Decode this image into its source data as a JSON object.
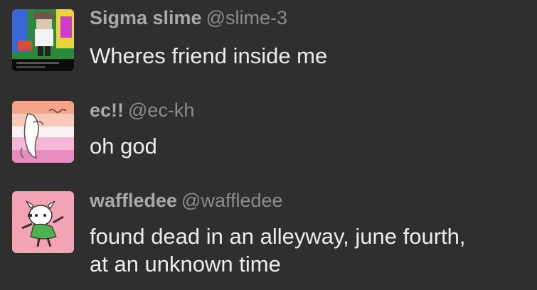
{
  "posts": [
    {
      "name": "Sigma slime",
      "handle": "@slime-3",
      "text": "Wheres friend inside me",
      "avatar_icon": "roblox-character-avatar"
    },
    {
      "name": "ec!!",
      "handle": "@ec-kh",
      "text": "oh god",
      "avatar_icon": "striped-flag-doodle-avatar"
    },
    {
      "name": "waffledee",
      "handle": "@waffledee",
      "text_lines": [
        "found dead in an alleyway, june fourth,",
        "at an unknown time"
      ],
      "avatar_icon": "goat-character-avatar"
    }
  ],
  "colors": {
    "background": "#2f2f2f",
    "name": "#a9a9a9",
    "handle": "#8b8b8b",
    "text": "#ececec"
  }
}
